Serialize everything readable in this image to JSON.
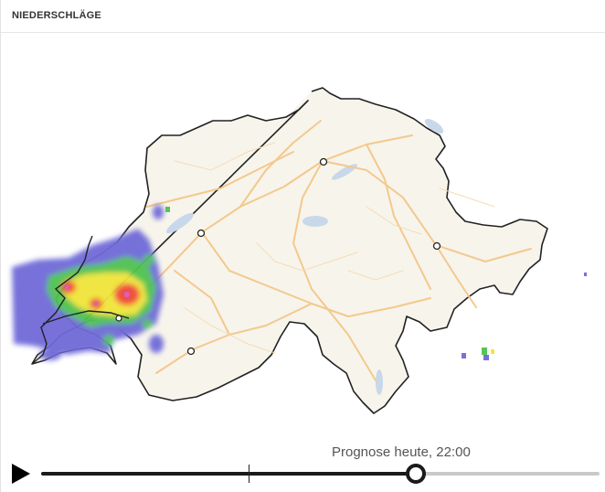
{
  "header": {
    "title": "NIEDERSCHLÄGE"
  },
  "map": {
    "region": "Switzerland",
    "layer": "precipitation-radar",
    "city_markers": 5,
    "colors": {
      "land": "#f7f4ec",
      "border": "#222222",
      "roads": "#f3c98c",
      "lakes": "#c8d8ea",
      "rain_light": "#6f6ad8",
      "rain_medium": "#4fc24f",
      "rain_heavy": "#f0e63a",
      "rain_very_heavy": "#f04a3a",
      "rain_extreme": "#d857c8"
    }
  },
  "player": {
    "play_icon": "play-icon",
    "time_label": "Prognose heute, 22:00",
    "progress_fraction": 0.671,
    "now_fraction": 0.372
  }
}
